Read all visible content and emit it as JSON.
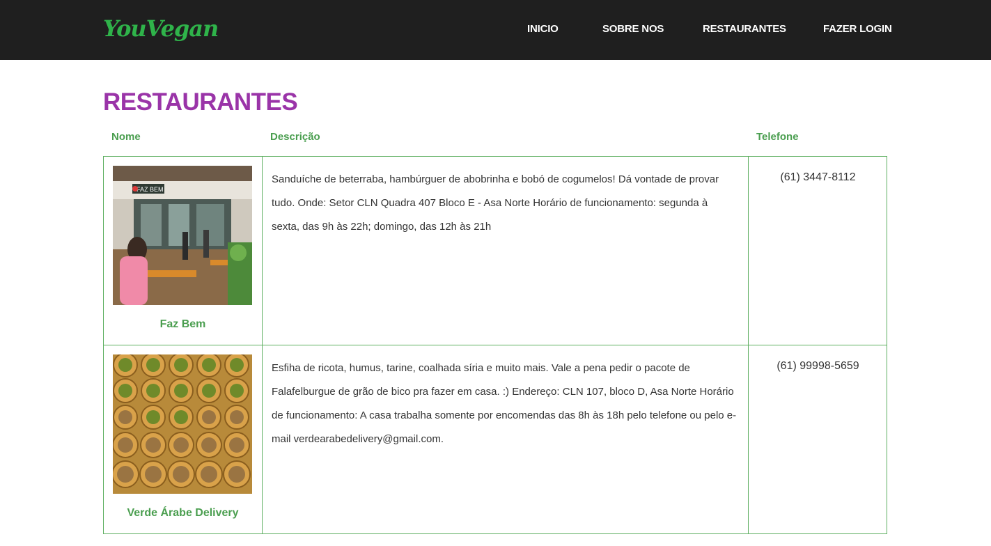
{
  "nav": {
    "logo": "YouVegan",
    "links": [
      "INICIO",
      "SOBRE NOS",
      "RESTAURANTES",
      "FAZER LOGIN"
    ]
  },
  "page": {
    "title": "RESTAURANTES"
  },
  "table": {
    "headers": [
      "Nome",
      "Descrição",
      "Telefone"
    ],
    "rows": [
      {
        "name": "Faz Bem",
        "description": "Sanduíche de beterraba, hambúrguer de abobrinha e bobó de cogumelos! Dá vontade de provar tudo. Onde: Setor CLN Quadra 407 Bloco E - Asa Norte Horário de funcionamento: segunda à sexta, das 9h às 22h; domingo, das 12h às 21h",
        "phone": "(61) 3447-8112",
        "sign_text": "FAZ BEM"
      },
      {
        "name": "Verde Árabe Delivery",
        "description": "Esfiha de ricota, humus, tarine, coalhada síria e muito mais. Vale a pena pedir o pacote de Falafelburgue de grão de bico pra fazer em casa. :) Endereço: CLN 107, bloco D, Asa Norte Horário de funcionamento: A casa trabalha somente por encomendas das 8h às 18h pelo telefone ou pelo e-mail verdearabedelivery@gmail.com.",
        "phone": "(61) 99998-5659"
      }
    ]
  },
  "colors": {
    "navbar": "#1f1f1f",
    "logo": "#2fb34a",
    "title": "#9a34a8",
    "accent_green": "#4a9e4f",
    "border": "#5cae5f"
  }
}
